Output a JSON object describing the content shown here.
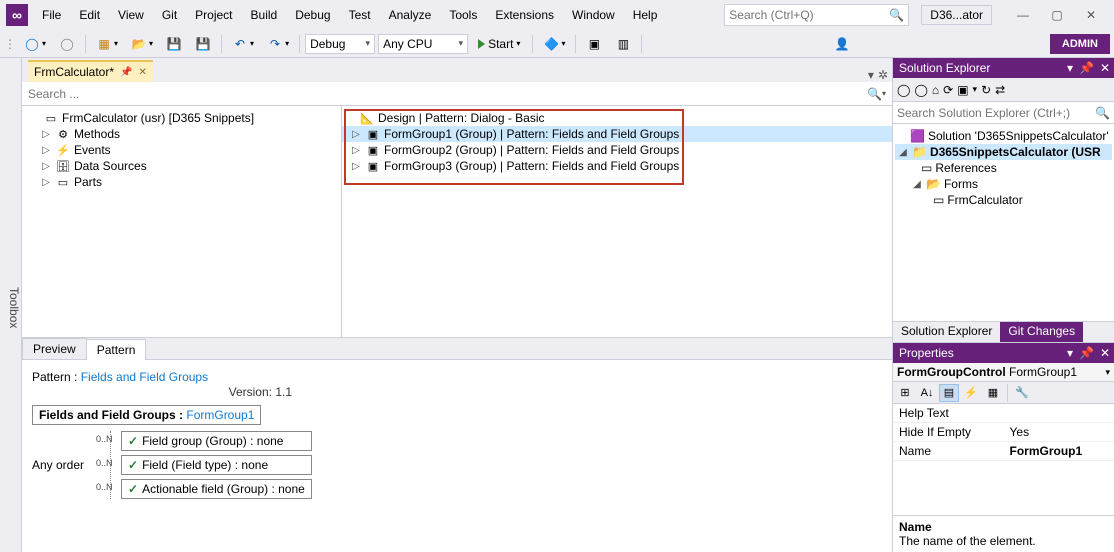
{
  "title_chip": "D36...ator",
  "menu": [
    "File",
    "Edit",
    "View",
    "Git",
    "Project",
    "Build",
    "Debug",
    "Test",
    "Analyze",
    "Tools",
    "Extensions",
    "Window",
    "Help"
  ],
  "global_search_placeholder": "Search (Ctrl+Q)",
  "admin_label": "ADMIN",
  "toolbar": {
    "config": "Debug",
    "platform": "Any CPU",
    "start": "Start"
  },
  "toolbox_label": "Toolbox",
  "doc_tab": {
    "title": "FrmCalculator*"
  },
  "designer_search_placeholder": "Search ...",
  "left_tree": {
    "root": "FrmCalculator (usr) [D365 Snippets]",
    "children": [
      "Methods",
      "Events",
      "Data Sources",
      "Parts"
    ]
  },
  "right_tree": {
    "root": "Design | Pattern: Dialog - Basic",
    "items": [
      "FormGroup1 (Group) | Pattern: Fields and Field Groups",
      "FormGroup2 (Group) | Pattern: Fields and Field Groups",
      "FormGroup3 (Group) | Pattern: Fields and Field Groups"
    ]
  },
  "bp_tabs": [
    "Preview",
    "Pattern"
  ],
  "pattern_panel": {
    "title_prefix": "Pattern : ",
    "title_link": "Fields and Field Groups",
    "version": "Version: 1.1",
    "group_prefix": "Fields and Field Groups : ",
    "group_link": "FormGroup1",
    "any_order": "Any order",
    "options": [
      "Field group  (Group)  :  none",
      "Field  (Field type)  :  none",
      "Actionable field  (Group)  :  none"
    ],
    "card": "0..N"
  },
  "solution_explorer": {
    "title": "Solution Explorer",
    "search_placeholder": "Search Solution Explorer (Ctrl+;)",
    "solution": "Solution 'D365SnippetsCalculator'",
    "project": "D365SnippetsCalculator (USR",
    "refs": "References",
    "forms": "Forms",
    "form": "FrmCalculator",
    "tabs": [
      "Solution Explorer",
      "Git Changes"
    ]
  },
  "properties": {
    "title": "Properties",
    "object_type": "FormGroupControl",
    "object_name": "FormGroup1",
    "rows": [
      {
        "k": "Help Text",
        "v": ""
      },
      {
        "k": "Hide If Empty",
        "v": "Yes"
      },
      {
        "k": "Name",
        "v": "FormGroup1",
        "bold": true
      }
    ],
    "desc_name": "Name",
    "desc_text": "The name of the element."
  }
}
